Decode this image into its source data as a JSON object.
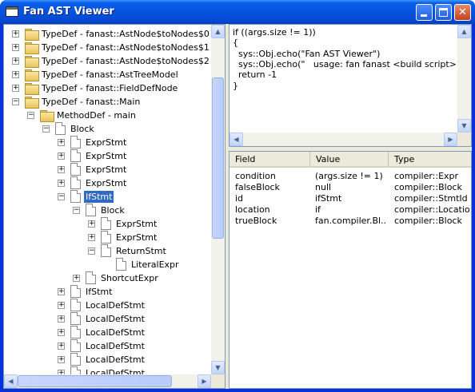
{
  "window": {
    "title": "Fan AST Viewer"
  },
  "tree": {
    "items": [
      {
        "label": "TypeDef - fanast::AstNode$toNodes$0",
        "expander": "+",
        "icon": "folder-icon",
        "level": 0
      },
      {
        "label": "TypeDef - fanast::AstNode$toNodes$1",
        "expander": "+",
        "icon": "folder-icon",
        "level": 0
      },
      {
        "label": "TypeDef - fanast::AstNode$toNodes$2",
        "expander": "+",
        "icon": "folder-icon",
        "level": 0
      },
      {
        "label": "TypeDef - fanast::AstTreeModel",
        "expander": "+",
        "icon": "folder-icon",
        "level": 0
      },
      {
        "label": "TypeDef - fanast::FieldDefNode",
        "expander": "+",
        "icon": "folder-icon",
        "level": 0
      },
      {
        "label": "TypeDef - fanast::Main",
        "expander": "−",
        "icon": "folder-icon",
        "level": 0
      },
      {
        "label": "MethodDef - main",
        "expander": "−",
        "icon": "folder-icon",
        "level": 1
      },
      {
        "label": "Block",
        "expander": "−",
        "icon": "document-icon",
        "level": 2
      },
      {
        "label": "ExprStmt",
        "expander": "+",
        "icon": "document-icon",
        "level": 3
      },
      {
        "label": "ExprStmt",
        "expander": "+",
        "icon": "document-icon",
        "level": 3
      },
      {
        "label": "ExprStmt",
        "expander": "+",
        "icon": "document-icon",
        "level": 3
      },
      {
        "label": "ExprStmt",
        "expander": "+",
        "icon": "document-icon",
        "level": 3
      },
      {
        "label": "IfStmt",
        "expander": "−",
        "icon": "document-icon",
        "level": 3,
        "selected": true
      },
      {
        "label": "Block",
        "expander": "−",
        "icon": "document-icon",
        "level": 4
      },
      {
        "label": "ExprStmt",
        "expander": "+",
        "icon": "document-icon",
        "level": 5
      },
      {
        "label": "ExprStmt",
        "expander": "+",
        "icon": "document-icon",
        "level": 5
      },
      {
        "label": "ReturnStmt",
        "expander": "−",
        "icon": "document-icon",
        "level": 5
      },
      {
        "label": "LiteralExpr",
        "expander": "",
        "icon": "document-icon",
        "level": 6
      },
      {
        "label": "ShortcutExpr",
        "expander": "+",
        "icon": "document-icon",
        "level": 4
      },
      {
        "label": "IfStmt",
        "expander": "+",
        "icon": "document-icon",
        "level": 3
      },
      {
        "label": "LocalDefStmt",
        "expander": "+",
        "icon": "document-icon",
        "level": 3
      },
      {
        "label": "LocalDefStmt",
        "expander": "+",
        "icon": "document-icon",
        "level": 3
      },
      {
        "label": "LocalDefStmt",
        "expander": "+",
        "icon": "document-icon",
        "level": 3
      },
      {
        "label": "LocalDefStmt",
        "expander": "+",
        "icon": "document-icon",
        "level": 3
      },
      {
        "label": "LocalDefStmt",
        "expander": "+",
        "icon": "document-icon",
        "level": 3
      },
      {
        "label": "LocalDefStmt",
        "expander": "+",
        "icon": "document-icon",
        "level": 3
      }
    ]
  },
  "code": {
    "lines": [
      "if ((args.size != 1))",
      "{",
      "  sys::Obj.echo(\"Fan AST Viewer\")",
      "  sys::Obj.echo(\"   usage: fan fanast <build script>\")",
      "  return -1",
      "}"
    ]
  },
  "fields": {
    "headers": [
      "Field",
      "Value",
      "Type"
    ],
    "rows": [
      [
        "condition",
        "(args.size != 1)",
        "compiler::Expr"
      ],
      [
        "falseBlock",
        "null",
        "compiler::Block"
      ],
      [
        "id",
        "ifStmt",
        "compiler::StmtId"
      ],
      [
        "location",
        "if",
        "compiler::Location"
      ],
      [
        "trueBlock",
        "fan.compiler.Bl...",
        "compiler::Block"
      ]
    ]
  },
  "colors": {
    "selection": "#316ac5",
    "titlebar": "#0553e0",
    "close_button": "#c4421e"
  }
}
